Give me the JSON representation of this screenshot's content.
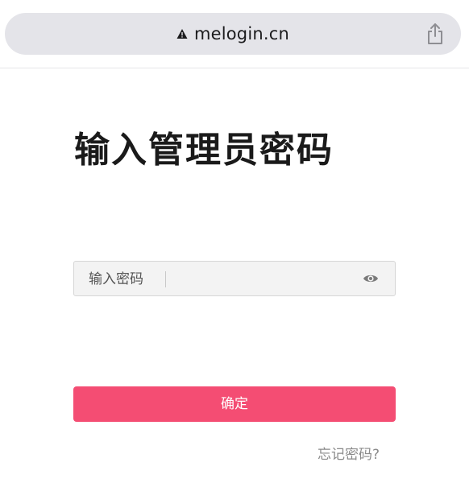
{
  "browser": {
    "url": "melogin.cn",
    "security_icon": "warning-triangle-icon",
    "share_icon": "share-icon"
  },
  "login": {
    "title": "输入管理员密码",
    "password_label": "输入密码",
    "password_value": "",
    "password_visibility_icon": "eye-icon",
    "confirm_label": "确定",
    "forgot_label": "忘记密码?"
  },
  "colors": {
    "accent": "#f44d73",
    "urlbar_bg": "#e4e4e9",
    "field_bg": "#f3f3f3"
  }
}
